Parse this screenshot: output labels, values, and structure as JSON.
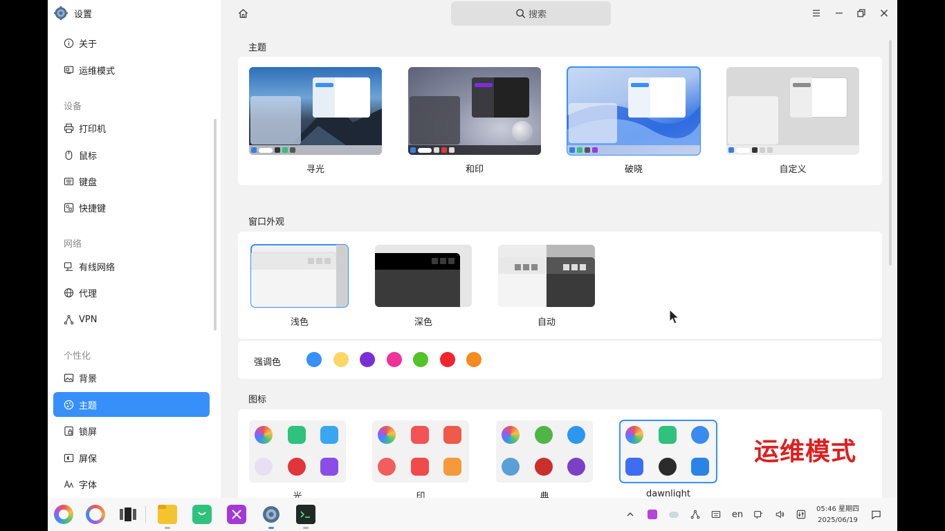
{
  "app": {
    "title": "设置",
    "icon": "gear-icon"
  },
  "sidebar": {
    "top_items": [
      {
        "label": "关于",
        "icon": "info-icon"
      },
      {
        "label": "运维模式",
        "icon": "ops-mode-icon"
      }
    ],
    "groups": [
      {
        "title": "设备",
        "items": [
          {
            "label": "打印机",
            "icon": "printer-icon"
          },
          {
            "label": "鼠标",
            "icon": "mouse-icon"
          },
          {
            "label": "键盘",
            "icon": "keyboard-icon"
          },
          {
            "label": "快捷键",
            "icon": "shortcut-icon"
          }
        ]
      },
      {
        "title": "网络",
        "items": [
          {
            "label": "有线网络",
            "icon": "wired-network-icon"
          },
          {
            "label": "代理",
            "icon": "proxy-icon"
          },
          {
            "label": "VPN",
            "icon": "vpn-icon"
          }
        ]
      },
      {
        "title": "个性化",
        "items": [
          {
            "label": "背景",
            "icon": "background-icon"
          },
          {
            "label": "主题",
            "icon": "theme-icon",
            "active": true
          },
          {
            "label": "锁屏",
            "icon": "lock-screen-icon"
          },
          {
            "label": "屏保",
            "icon": "screensaver-icon"
          },
          {
            "label": "字体",
            "icon": "font-icon"
          }
        ]
      }
    ]
  },
  "topbar": {
    "search_label": "搜索"
  },
  "theme": {
    "title": "主题",
    "options": [
      {
        "label": "寻光"
      },
      {
        "label": "和印"
      },
      {
        "label": "破晓",
        "selected": true
      },
      {
        "label": "自定义"
      }
    ]
  },
  "window_appearance": {
    "title": "窗口外观",
    "options": [
      {
        "label": "浅色",
        "selected": true
      },
      {
        "label": "深色"
      },
      {
        "label": "自动"
      }
    ]
  },
  "accent": {
    "label": "强调色",
    "colors": [
      "#3790fa",
      "#fdd664",
      "#7a2fd6",
      "#f0329a",
      "#51c428",
      "#f0232e",
      "#f58b20"
    ]
  },
  "icons": {
    "title": "图标",
    "options": [
      {
        "label": "光"
      },
      {
        "label": "印"
      },
      {
        "label": "典"
      },
      {
        "label": "dawnlight",
        "selected": true
      }
    ]
  },
  "overlay": {
    "ops_mode": "运维模式"
  },
  "taskbar": {
    "language": "en",
    "time": "05:46 星期四",
    "date": "2025/06/19"
  }
}
